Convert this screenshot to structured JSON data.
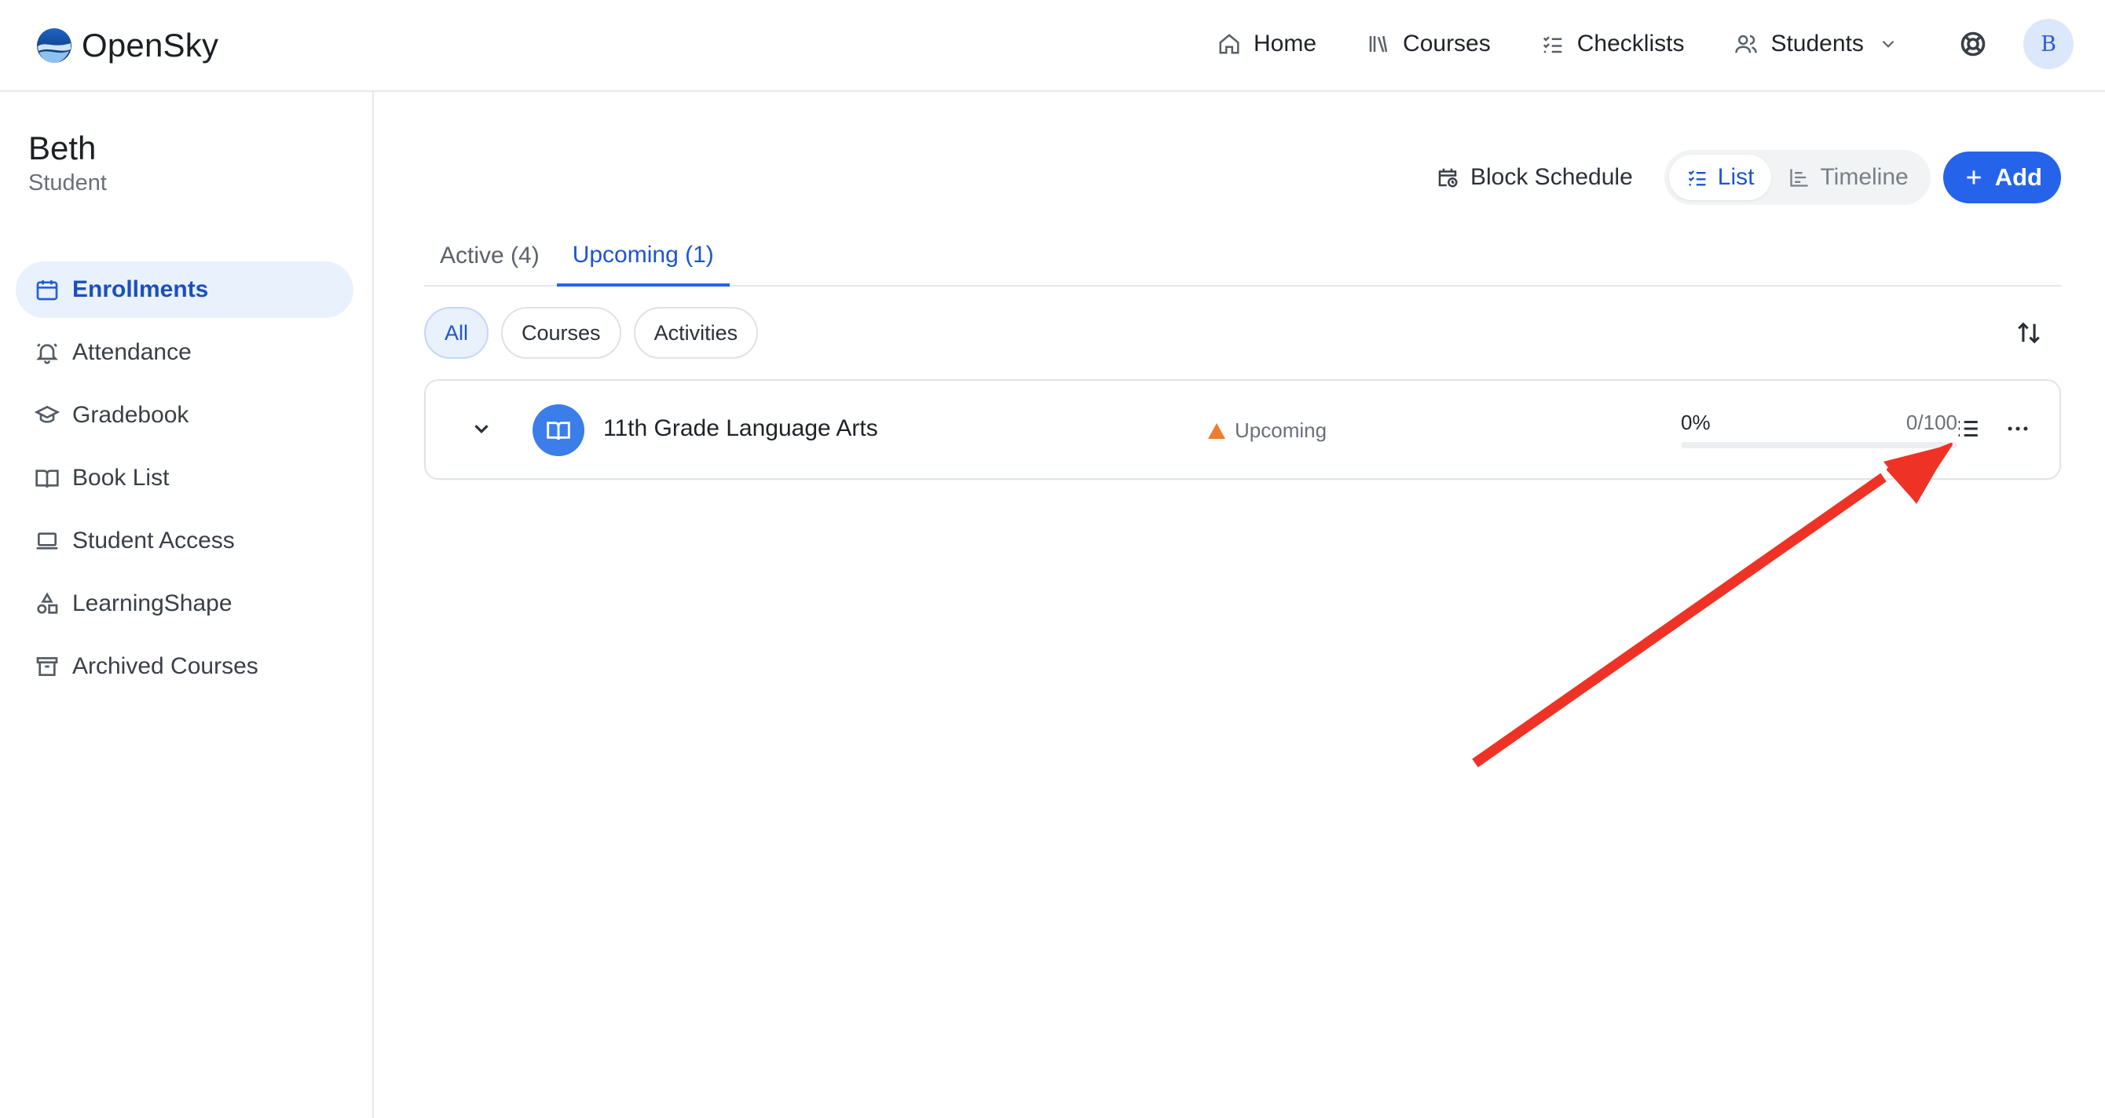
{
  "brand": {
    "name": "OpenSky"
  },
  "nav": {
    "home": "Home",
    "courses": "Courses",
    "checklists": "Checklists",
    "students": "Students"
  },
  "user": {
    "avatar_initial": "B"
  },
  "student": {
    "name": "Beth",
    "role": "Student"
  },
  "sidebar": {
    "items": [
      {
        "label": "Enrollments",
        "icon": "calendar-icon",
        "active": true
      },
      {
        "label": "Attendance",
        "icon": "bell-icon",
        "active": false
      },
      {
        "label": "Gradebook",
        "icon": "graduation-cap-icon",
        "active": false
      },
      {
        "label": "Book List",
        "icon": "open-book-icon",
        "active": false
      },
      {
        "label": "Student Access",
        "icon": "laptop-icon",
        "active": false
      },
      {
        "label": "LearningShape",
        "icon": "shapes-icon",
        "active": false
      },
      {
        "label": "Archived Courses",
        "icon": "archive-icon",
        "active": false
      }
    ]
  },
  "toolbar": {
    "block_schedule": "Block Schedule",
    "list": "List",
    "timeline": "Timeline",
    "add": "Add",
    "active_view": "list"
  },
  "tabs": {
    "active": "Active (4)",
    "upcoming": "Upcoming (1)",
    "selected": "upcoming"
  },
  "filters": {
    "all": "All",
    "courses": "Courses",
    "activities": "Activities",
    "selected": "all"
  },
  "course": {
    "title": "11th Grade Language Arts",
    "status": "Upcoming",
    "progress_pct": "0%",
    "score": "0/100",
    "progress_fraction": 0
  },
  "colors": {
    "accent": "#2563eb",
    "status_upcoming": "#f07c2e",
    "annotation_arrow": "#ee3326"
  }
}
